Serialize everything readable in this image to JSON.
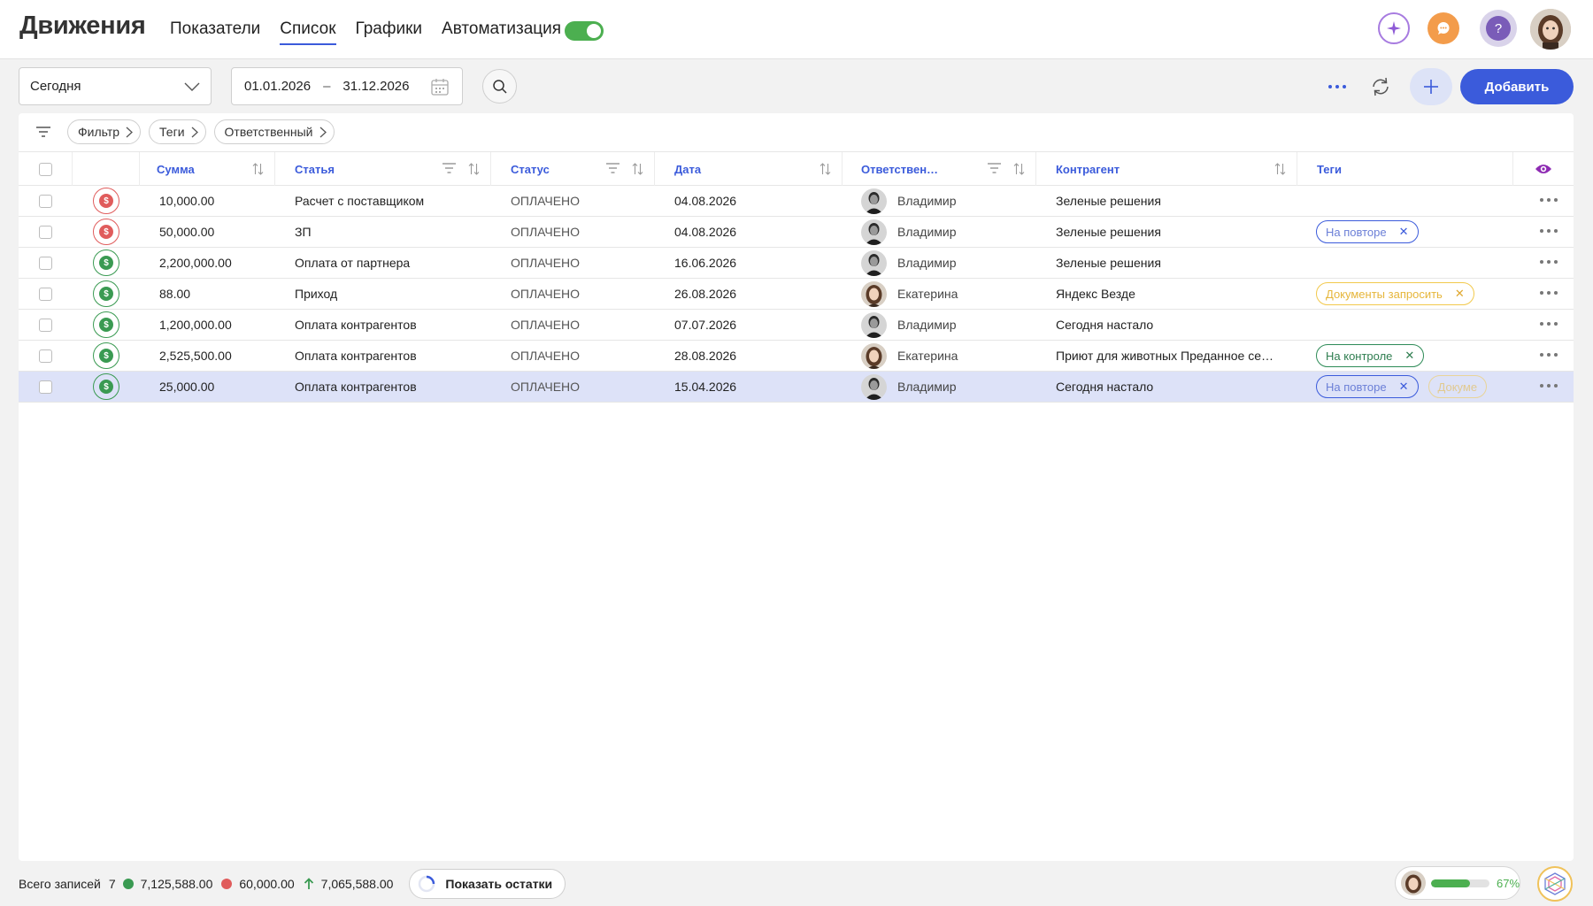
{
  "header": {
    "title": "Движения",
    "tabs": [
      {
        "label": "Показатели",
        "active": false
      },
      {
        "label": "Список",
        "active": true
      },
      {
        "label": "Графики",
        "active": false
      },
      {
        "label": "Автоматизация",
        "active": false
      }
    ],
    "toggle_on": true,
    "help_label": "?"
  },
  "toolbar": {
    "period": "Сегодня",
    "date_from": "01.01.2026",
    "date_sep": "–",
    "date_to": "31.12.2026",
    "add_label": "Добавить"
  },
  "filters": {
    "chips": [
      "Фильтр",
      "Теги",
      "Ответственный"
    ]
  },
  "columns": {
    "sum": "Сумма",
    "article": "Статья",
    "status": "Статус",
    "date": "Дата",
    "responsible": "Ответствен…",
    "counterparty": "Контрагент",
    "tags": "Теги"
  },
  "rows": [
    {
      "type": "expense",
      "sum": "10,000.00",
      "article": "Расчет с поставщиком",
      "status": "ОПЛАЧЕНО",
      "date": "04.08.2026",
      "person": "Владимир",
      "person_kind": "man",
      "counterparty": "Зеленые решения",
      "tags": [],
      "selected": false
    },
    {
      "type": "expense",
      "sum": "50,000.00",
      "article": "ЗП",
      "status": "ОПЛАЧЕНО",
      "date": "04.08.2026",
      "person": "Владимир",
      "person_kind": "man",
      "counterparty": "Зеленые решения",
      "tags": [
        {
          "label": "На повторе",
          "color": "blue"
        }
      ],
      "selected": false
    },
    {
      "type": "income",
      "sum": "2,200,000.00",
      "article": "Оплата от партнера",
      "status": "ОПЛАЧЕНО",
      "date": "16.06.2026",
      "person": "Владимир",
      "person_kind": "man",
      "counterparty": "Зеленые решения",
      "tags": [],
      "selected": false
    },
    {
      "type": "income",
      "sum": "88.00",
      "article": "Приход",
      "status": "ОПЛАЧЕНО",
      "date": "26.08.2026",
      "person": "Екатерина",
      "person_kind": "woman",
      "counterparty": "Яндекс Везде",
      "tags": [
        {
          "label": "Документы запросить",
          "color": "yellow"
        }
      ],
      "selected": false
    },
    {
      "type": "income",
      "sum": "1,200,000.00",
      "article": "Оплата контрагентов",
      "status": "ОПЛАЧЕНО",
      "date": "07.07.2026",
      "person": "Владимир",
      "person_kind": "man",
      "counterparty": "Сегодня настало",
      "tags": [],
      "selected": false
    },
    {
      "type": "income",
      "sum": "2,525,500.00",
      "article": "Оплата контрагентов",
      "status": "ОПЛАЧЕНО",
      "date": "28.08.2026",
      "person": "Екатерина",
      "person_kind": "woman",
      "counterparty": "Приют для животных Преданное се…",
      "tags": [
        {
          "label": "На контроле",
          "color": "green"
        }
      ],
      "selected": false
    },
    {
      "type": "income",
      "sum": "25,000.00",
      "article": "Оплата контрагентов",
      "status": "ОПЛАЧЕНО",
      "date": "15.04.2026",
      "person": "Владимир",
      "person_kind": "man",
      "counterparty": "Сегодня настало",
      "tags": [
        {
          "label": "На повторе",
          "color": "blue"
        },
        {
          "label": "Докуме",
          "color": "yellow",
          "truncated": true
        }
      ],
      "selected": true
    }
  ],
  "footer": {
    "total_label": "Всего записей",
    "total_count": "7",
    "income": "7,125,588.00",
    "expense": "60,000.00",
    "balance": "7,065,588.00",
    "show_label": "Показать остатки",
    "progress_percent": 67,
    "progress_label": "67%"
  },
  "colors": {
    "accent": "#3b5bdb",
    "income": "#3a9a52",
    "expense": "#e05c5c",
    "toggle": "#4caf50"
  }
}
